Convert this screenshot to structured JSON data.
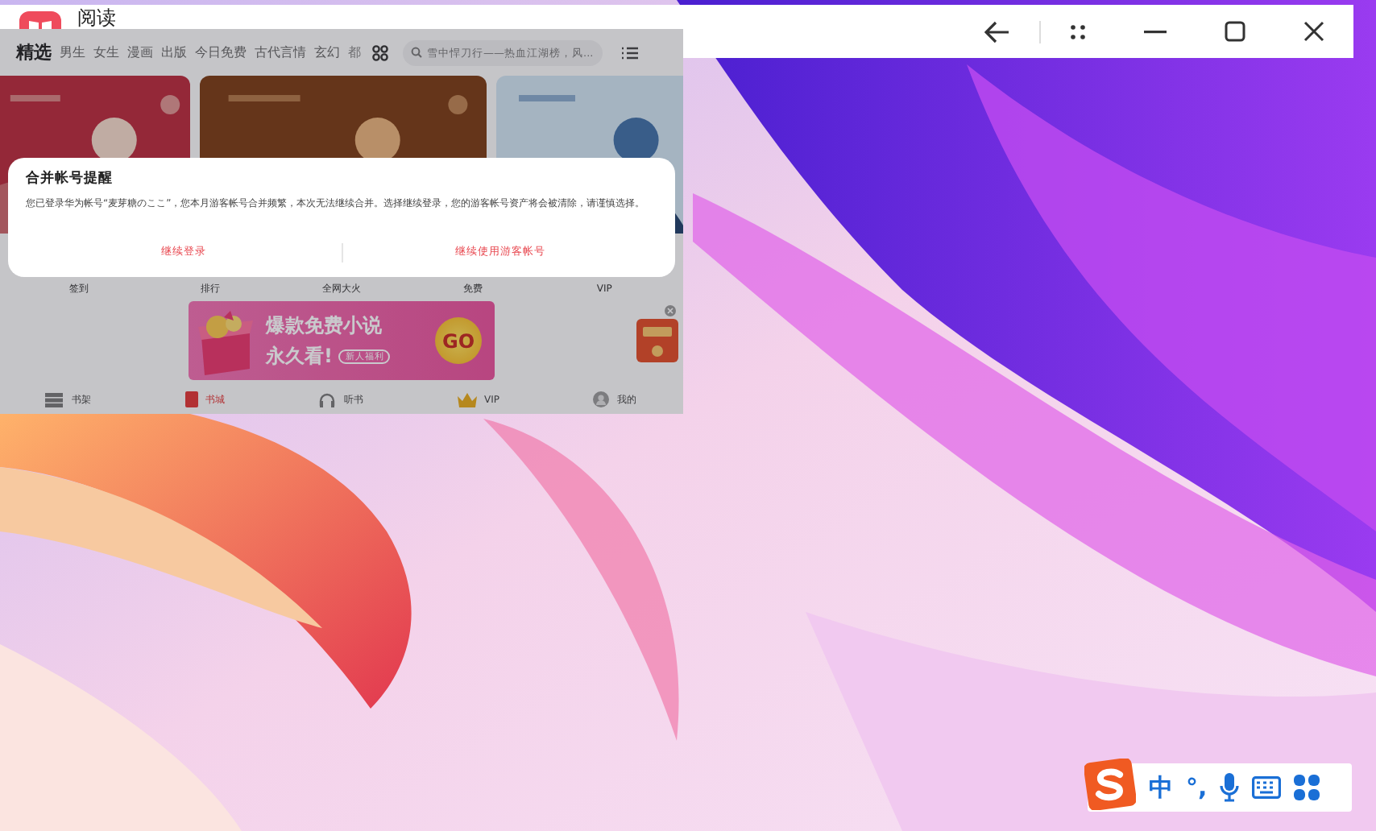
{
  "title_bar": {
    "title": "阅读"
  },
  "app": {
    "tabs": [
      {
        "label": "精选",
        "selected": true
      },
      {
        "label": "男生",
        "selected": false
      },
      {
        "label": "女生",
        "selected": false
      },
      {
        "label": "漫画",
        "selected": false
      },
      {
        "label": "出版",
        "selected": false
      },
      {
        "label": "今日免费",
        "selected": false
      },
      {
        "label": "古代言情",
        "selected": false
      },
      {
        "label": "玄幻",
        "selected": false
      },
      {
        "label": "都",
        "selected": false
      }
    ],
    "search": {
      "placeholder": "雪中悍刀行——热血江湖榜，风..."
    },
    "categories": [
      "签到",
      "排行",
      "全网大火",
      "免费",
      "VIP"
    ],
    "promo": {
      "headline": "爆款免费小说",
      "subline": "永久看!",
      "badge": "新人福利",
      "button": "GO"
    },
    "nav": [
      {
        "label": "书架",
        "selected": false
      },
      {
        "label": "书城",
        "selected": true
      },
      {
        "label": "听书",
        "selected": false
      },
      {
        "label": "VIP",
        "selected": false
      },
      {
        "label": "我的",
        "selected": false
      }
    ]
  },
  "dialog": {
    "title": "合并帐号提醒",
    "message": "您已登录华为帐号“麦芽糖のここ”，您本月游客帐号合并频繁，本次无法继续合并。选择继续登录，您的游客帐号资产将会被清除，请谨慎选择。",
    "buttons": [
      "继续登录",
      "继续使用游客帐号"
    ]
  },
  "ime": {
    "mode": "中",
    "punctuation": "°,"
  }
}
